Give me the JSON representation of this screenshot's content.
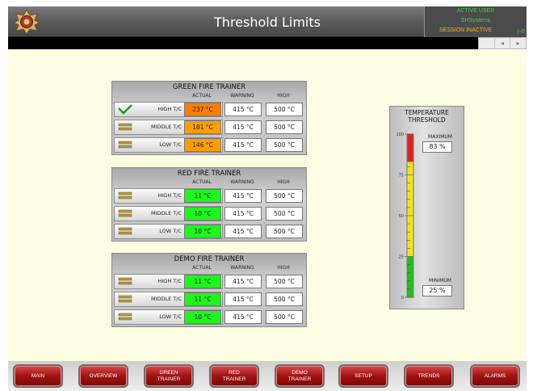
{
  "header": {
    "title": "Threshold Limits",
    "logo_icon": "fire-badge-icon",
    "status": {
      "user_label": "ACTIVE USER",
      "user_name": "SHSystems",
      "session": "SESSION INACTIVE",
      "indicator": "(-0"
    },
    "scroll_left": "◂",
    "scroll_right": "▸"
  },
  "column_headers": {
    "actual": "ACTUAL",
    "warning": "WARNING",
    "high": "HIGH"
  },
  "trainers": [
    {
      "title": "GREEN FIRE TRAINER",
      "rows": [
        {
          "label": "HIGH T/C",
          "actual": "237 °C",
          "warning": "415 °C",
          "high": "500 °C",
          "indicator": "check",
          "actual_color": "#ff7d00"
        },
        {
          "label": "MIDDLE T/C",
          "actual": "181 °C",
          "warning": "415 °C",
          "high": "500 °C",
          "indicator": "equals",
          "actual_color": "#ff9d00"
        },
        {
          "label": "LOW T/C",
          "actual": "146 °C",
          "warning": "415 °C",
          "high": "500 °C",
          "indicator": "equals",
          "actual_color": "#ff9d00"
        }
      ]
    },
    {
      "title": "RED FIRE TRAINER",
      "rows": [
        {
          "label": "HIGH T/C",
          "actual": "11 °C",
          "warning": "415 °C",
          "high": "500 °C",
          "indicator": "equals",
          "actual_color": "#1df51d"
        },
        {
          "label": "MIDDLE T/C",
          "actual": "10 °C",
          "warning": "415 °C",
          "high": "500 °C",
          "indicator": "equals",
          "actual_color": "#1df51d"
        },
        {
          "label": "LOW T/C",
          "actual": "10 °C",
          "warning": "415 °C",
          "high": "500 °C",
          "indicator": "equals",
          "actual_color": "#1df51d"
        }
      ]
    },
    {
      "title": "DEMO FIRE TRAINER",
      "rows": [
        {
          "label": "HIGH T/C",
          "actual": "11 °C",
          "warning": "415 °C",
          "high": "500 °C",
          "indicator": "equals",
          "actual_color": "#1df51d"
        },
        {
          "label": "MIDDLE T/C",
          "actual": "11 °C",
          "warning": "415 °C",
          "high": "500 °C",
          "indicator": "equals",
          "actual_color": "#1df51d"
        },
        {
          "label": "LOW T/C",
          "actual": "10 °C",
          "warning": "415 °C",
          "high": "500 °C",
          "indicator": "equals",
          "actual_color": "#1df51d"
        }
      ]
    }
  ],
  "threshold": {
    "title_line1": "TEMPERATURE",
    "title_line2": "THRESHOLD",
    "scale_ticks": [
      "100",
      "75",
      "50",
      "25",
      "0"
    ],
    "maximum_label": "MAXIMUM",
    "maximum_value": "83 %",
    "minimum_label": "MINIMUM",
    "minimum_value": "25 %",
    "colors": {
      "high": "#e8201a",
      "mid": "#f2e21a",
      "low": "#20c020"
    }
  },
  "nav": [
    "MAIN",
    "OVERVIEW",
    "GREEN TRAINER",
    "RED TRAINER",
    "DEMO TRAINER",
    "SETUP",
    "TRENDS",
    "ALARMS"
  ]
}
